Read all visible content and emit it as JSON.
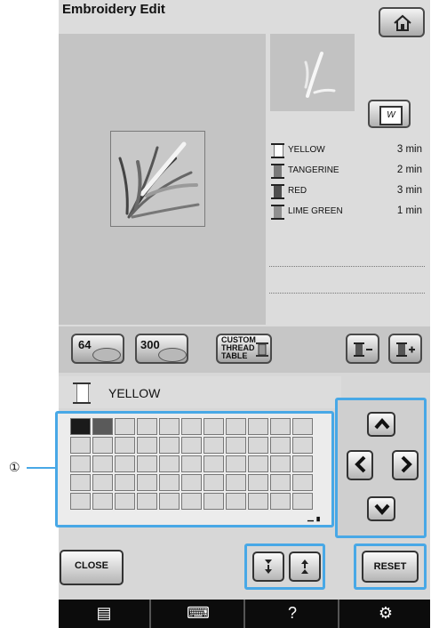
{
  "header": {
    "title": "Embroidery Edit"
  },
  "threads": [
    {
      "name": "YELLOW",
      "time": "3 min",
      "color": "#ffffff"
    },
    {
      "name": "TANGERINE",
      "time": "2 min",
      "color": "#7a7a7a"
    },
    {
      "name": "RED",
      "time": "3 min",
      "color": "#4e4e4e"
    },
    {
      "name": "LIME GREEN",
      "time": "1 min",
      "color": "#8f8f8f"
    }
  ],
  "toolbar": {
    "btn64_label": "64",
    "btn300_label": "300",
    "custom_label": "CUSTOM THREAD TABLE",
    "minus_icon": "spool-minus-icon",
    "plus_icon": "spool-plus-icon"
  },
  "selection": {
    "thread_name": "YELLOW"
  },
  "grid": {
    "rows": 5,
    "cols": 11,
    "selected_colors": [
      "#1a1a1a",
      "#5a5a5a"
    ]
  },
  "callout": "①",
  "buttons": {
    "close_label": "CLOSE",
    "reset_label": "RESET"
  },
  "bottom_bar": {
    "icons": [
      "page-icon",
      "sewing-machine-icon",
      "help-icon",
      "settings-icon"
    ],
    "help_text": "?"
  },
  "colors": {
    "highlight": "#48a8e6",
    "screen_bg": "#dcdcdc",
    "bar_bg": "#0c0c0c"
  }
}
